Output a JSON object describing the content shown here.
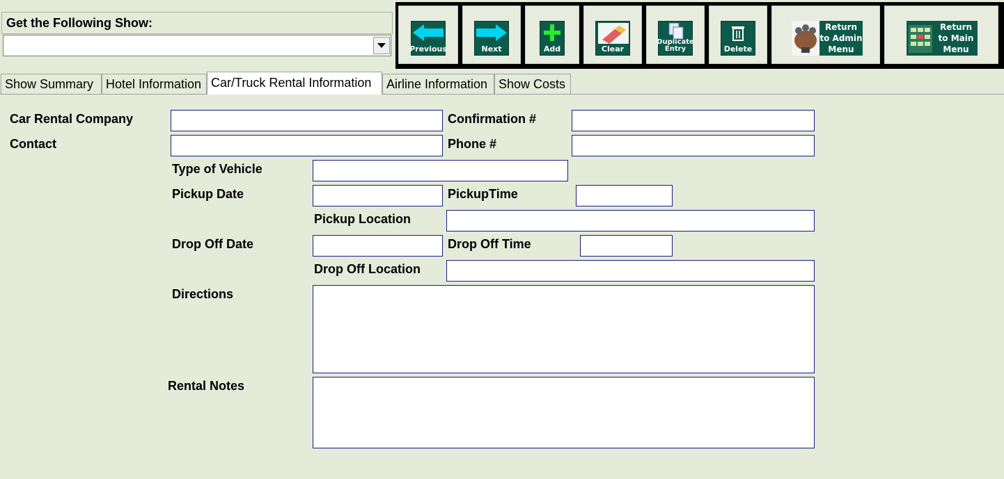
{
  "show_selector": {
    "label": "Get the Following Show:",
    "value": ""
  },
  "toolbar": {
    "previous": "Previous",
    "next": "Next",
    "add": "Add",
    "clear": "Clear",
    "duplicate": "Duplicate Entry",
    "delete": "Delete",
    "return_admin": "Return to Admin Menu",
    "return_main": "Return to Main Menu"
  },
  "tabs": [
    {
      "label": "Show Summary"
    },
    {
      "label": "Hotel Information"
    },
    {
      "label": "Car/Truck Rental Information"
    },
    {
      "label": "Airline Information"
    },
    {
      "label": "Show Costs"
    }
  ],
  "form": {
    "car_rental_company": {
      "label": "Car Rental Company",
      "value": ""
    },
    "confirmation": {
      "label": "Confirmation #",
      "value": ""
    },
    "contact": {
      "label": "Contact",
      "value": ""
    },
    "phone": {
      "label": "Phone #",
      "value": ""
    },
    "vehicle_type": {
      "label": "Type of Vehicle",
      "value": ""
    },
    "pickup_date": {
      "label": "Pickup Date",
      "value": ""
    },
    "pickup_time": {
      "label": "PickupTime",
      "value": ""
    },
    "pickup_location": {
      "label": "Pickup Location",
      "value": ""
    },
    "dropoff_date": {
      "label": "Drop Off Date",
      "value": ""
    },
    "dropoff_time": {
      "label": "Drop Off Time",
      "value": ""
    },
    "dropoff_location": {
      "label": "Drop Off Location",
      "value": ""
    },
    "directions": {
      "label": "Directions",
      "value": ""
    },
    "rental_notes": {
      "label": "Rental Notes",
      "value": ""
    }
  },
  "colors": {
    "background": "#e4ebd9",
    "toolbar": "#000000",
    "button_icon": "#0d5a4a",
    "arrow": "#00d4f0",
    "add_plus": "#2ee82e",
    "field_border": "#1a1a80"
  }
}
